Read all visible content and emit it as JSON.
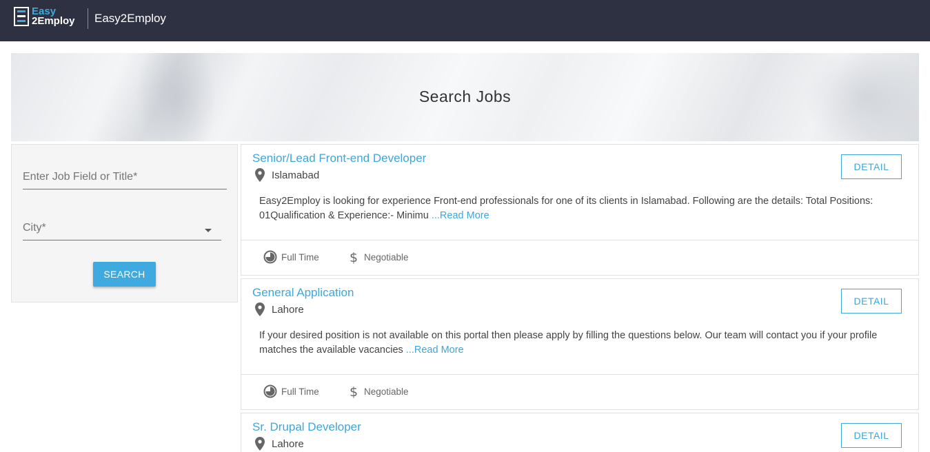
{
  "header": {
    "logo_top": "Easy",
    "logo_bottom": "2Employ",
    "app_name": "Easy2Employ"
  },
  "hero": {
    "title": "Search Jobs"
  },
  "filters": {
    "job_field_label": "Enter Job Field or Title*",
    "city_label": "City*",
    "search_label": "SEARCH"
  },
  "jobs": [
    {
      "title": "Senior/Lead Front-end Developer",
      "location": "Islamabad",
      "description": "Easy2Employ is looking for experience Front-end professionals for one of its clients in Islamabad. Following are the details: Total Positions: 01Qualification & Experience:- Minimu ",
      "read_more": "...Read More",
      "detail_label": "DETAIL",
      "type": "Full Time",
      "salary": "Negotiable"
    },
    {
      "title": "General Application",
      "location": "Lahore",
      "description": "If your desired position is not available on this portal then please apply by filling the questions below. Our team will contact you if your profile matches the available vacancies ",
      "read_more": "...Read More",
      "detail_label": "DETAIL",
      "type": "Full Time",
      "salary": "Negotiable"
    },
    {
      "title": "Sr. Drupal Developer",
      "location": "Lahore",
      "detail_label": "DETAIL"
    }
  ],
  "colors": {
    "header_bg": "#2e3142",
    "accent": "#3ea6d9"
  },
  "icons": {
    "logo": "e2e-logo-icon",
    "location": "map-pin-icon",
    "job_type": "clock-icon",
    "salary": "dollar-icon",
    "dropdown": "caret-down-icon"
  }
}
